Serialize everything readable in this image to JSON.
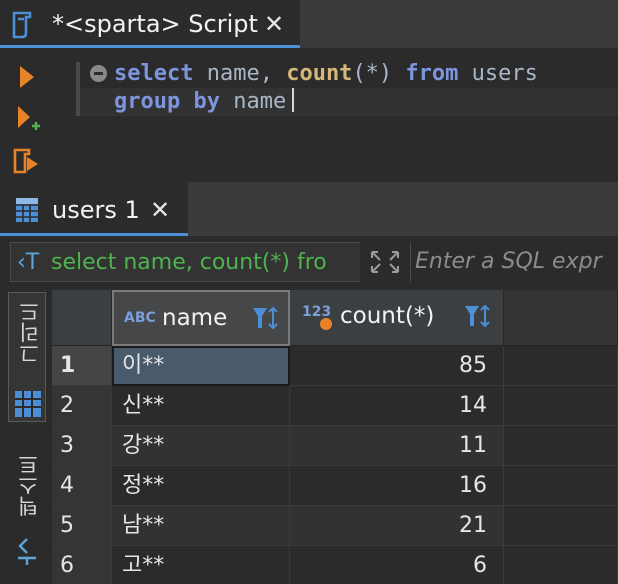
{
  "editor_tab": {
    "title": "*<sparta> Script",
    "close": "✕"
  },
  "editor": {
    "line1": {
      "kw1": "select",
      "t1": " name, ",
      "fn": "count",
      "t2": "(*) ",
      "kw2": "from",
      "t3": " users"
    },
    "line2": {
      "kw1": "group",
      "t1": " ",
      "kw2": "by",
      "t2": " name"
    }
  },
  "results_tab": {
    "title": "users 1",
    "close": "✕"
  },
  "filter": {
    "query_icon": "‹T",
    "query_text": "select name, count(*) fro",
    "placeholder": "Enter a SQL expr"
  },
  "side_panel": {
    "grid_label": "그리드",
    "text_label": "텍스트"
  },
  "grid": {
    "columns": [
      {
        "type_tag": "ABC",
        "label": "name"
      },
      {
        "type_tag": "123",
        "label": "count(*)"
      }
    ],
    "rows": [
      {
        "num": "1",
        "name": "이**",
        "count": "85"
      },
      {
        "num": "2",
        "name": "신**",
        "count": "14"
      },
      {
        "num": "3",
        "name": "강**",
        "count": "11"
      },
      {
        "num": "4",
        "name": "정**",
        "count": "16"
      },
      {
        "num": "5",
        "name": "남**",
        "count": "21"
      },
      {
        "num": "6",
        "name": "고**",
        "count": "6"
      }
    ]
  },
  "colors": {
    "accent": "#4d8fd6",
    "keyword": "#7d95dd",
    "function": "#d5b778",
    "query": "#4fb34f",
    "run": "#e8832a"
  }
}
